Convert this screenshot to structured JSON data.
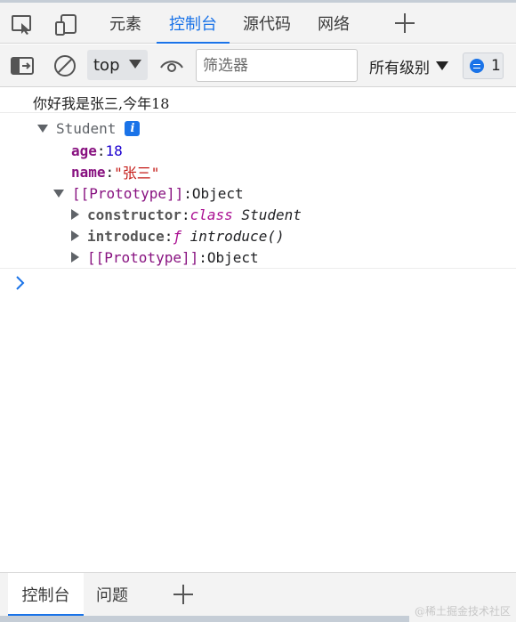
{
  "tabbar": {
    "tabs": [
      {
        "label": "元素"
      },
      {
        "label": "控制台"
      },
      {
        "label": "源代码"
      },
      {
        "label": "网络"
      }
    ],
    "active_tab": "控制台",
    "icons": [
      "inspect-element-icon",
      "device-toolbar-icon",
      "add-tab-icon"
    ]
  },
  "toolbar": {
    "context": "top",
    "filter_placeholder": "筛选器",
    "levels": "所有级别",
    "issues_count": "1",
    "icons": [
      "sidebar-toggle-icon",
      "clear-console-icon",
      "live-expression-eye-icon",
      "issues-icon"
    ]
  },
  "console": {
    "message": "你好我是张三,今年18",
    "object": {
      "class_name": "Student",
      "props": [
        {
          "key": "age",
          "sep": ": ",
          "value": "18"
        },
        {
          "key": "name",
          "sep": ": ",
          "value": "\"张三\""
        }
      ],
      "prototype": {
        "label": "[[Prototype]]",
        "sep": ": ",
        "value": "Object",
        "children": [
          {
            "key": "constructor",
            "sep": ": ",
            "keyword": "class",
            "value": "Student"
          },
          {
            "key": "introduce",
            "sep": ": ",
            "keyword": "ƒ",
            "value": "introduce()"
          },
          {
            "key": "[[Prototype]]",
            "sep": ": ",
            "value": "Object"
          }
        ]
      }
    },
    "prompt_symbol": "›"
  },
  "drawer": {
    "tabs": [
      {
        "label": "控制台"
      },
      {
        "label": "问题"
      }
    ]
  },
  "watermark": "@稀土掘金技术社区",
  "colors": {
    "accent": "#1a73e8",
    "key": "#881280",
    "number": "#1c00cf",
    "string": "#c41a16",
    "keyword": "#aa0d91"
  }
}
